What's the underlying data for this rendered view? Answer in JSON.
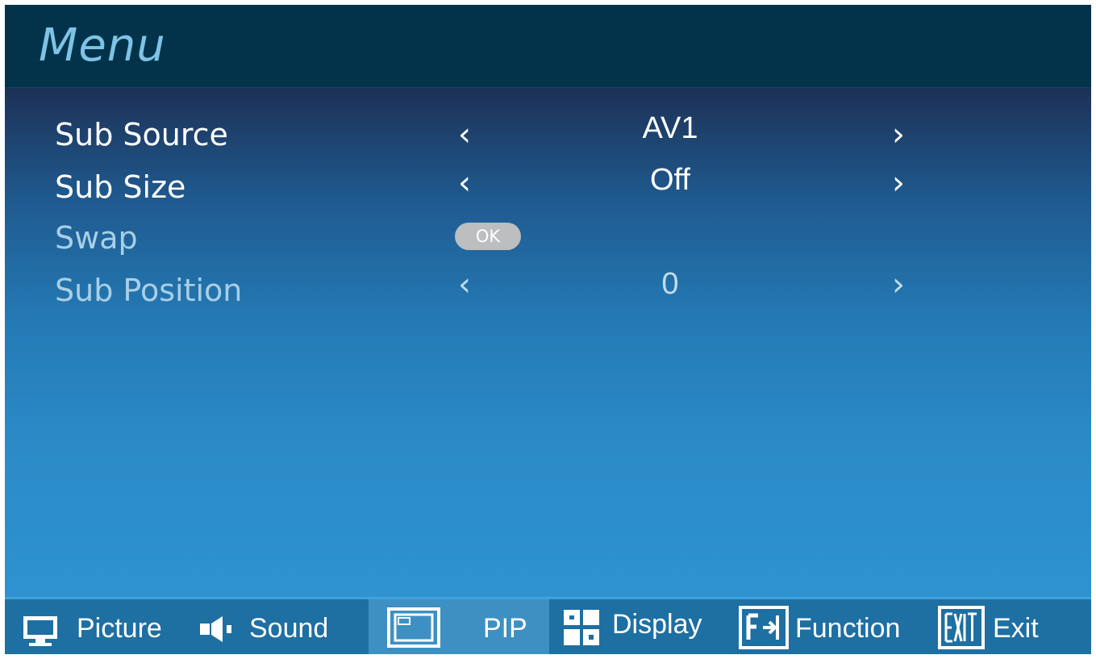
{
  "header": {
    "title": "Menu"
  },
  "rows": [
    {
      "label": "Sub Source",
      "value": "AV1",
      "enabled": true
    },
    {
      "label": "Sub Size",
      "value": "Off",
      "enabled": true
    },
    {
      "label": "Swap",
      "button_label": "OK",
      "enabled": false
    },
    {
      "label": "Sub Position",
      "value": "0",
      "enabled": false
    }
  ],
  "arrows": {
    "left": "‹",
    "right": "›"
  },
  "nav": {
    "active": "PIP",
    "items": [
      {
        "label": "Picture",
        "icon": "monitor-icon"
      },
      {
        "label": "Sound",
        "icon": "speaker-icon"
      },
      {
        "label": "PIP",
        "icon": "pip-window-icon"
      },
      {
        "label": "Display",
        "icon": "grid-display-icon"
      },
      {
        "label": "Function",
        "icon": "function-icon"
      },
      {
        "label": "Exit",
        "icon": "exit-icon"
      }
    ]
  },
  "colors": {
    "title_bar": "#02334a",
    "title_text": "#7ec3e6",
    "nav_bar": "#1e6fa2",
    "nav_active": "#3e90c3",
    "ok_button": "#bdbec0"
  }
}
